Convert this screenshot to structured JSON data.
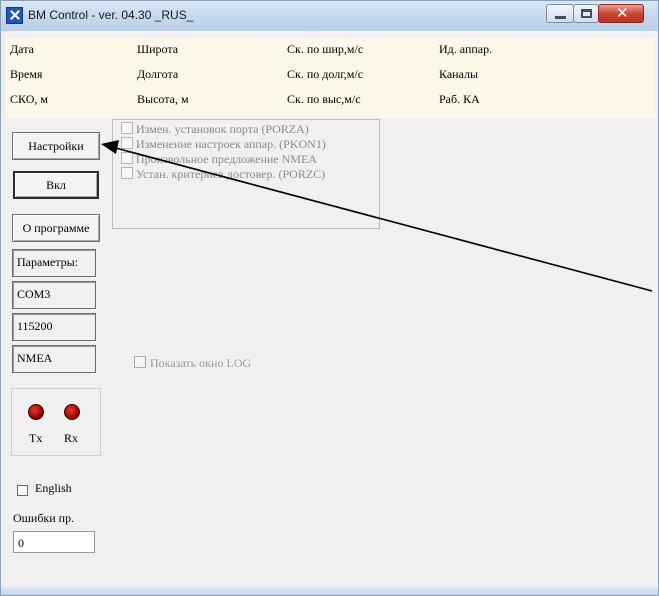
{
  "window": {
    "title": "BM Control - ver. 04.30 _RUS_"
  },
  "header": {
    "col1": [
      "Дата",
      "Время",
      "СКО, м"
    ],
    "col2": [
      "Широта",
      "Долгота",
      "Высота, м"
    ],
    "col3": [
      "Ск. по шир,м/с",
      "Ск. по долг,м/с",
      "Ск. по выс,м/с"
    ],
    "col4": [
      "Ид. аппар.",
      "Каналы",
      "Раб. КА"
    ]
  },
  "buttons": {
    "settings": "Настройки",
    "on": "Вкл",
    "about": "О программе"
  },
  "parameters": {
    "title": "Параметры:",
    "port": "COM3",
    "speed": "115200",
    "protocol": "NMEA"
  },
  "indicators": {
    "tx": "Tx",
    "rx": "Rx"
  },
  "language": {
    "english": "English"
  },
  "errors": {
    "label": "Ошибки пр.",
    "value": "0"
  },
  "options": [
    "Измен. установок порта (PORZA)",
    "Изменение настроек аппар. (PKON1)",
    "Произвольное предложение NMEA",
    "Устан. критериев достовер. (PORZC)"
  ],
  "log": {
    "label": "Показать окно LOG"
  },
  "colors": {
    "info_bg": "#fdf7ea",
    "window_bg": "#f0f0f0",
    "led": "#d01010",
    "arrow": "#000000"
  }
}
